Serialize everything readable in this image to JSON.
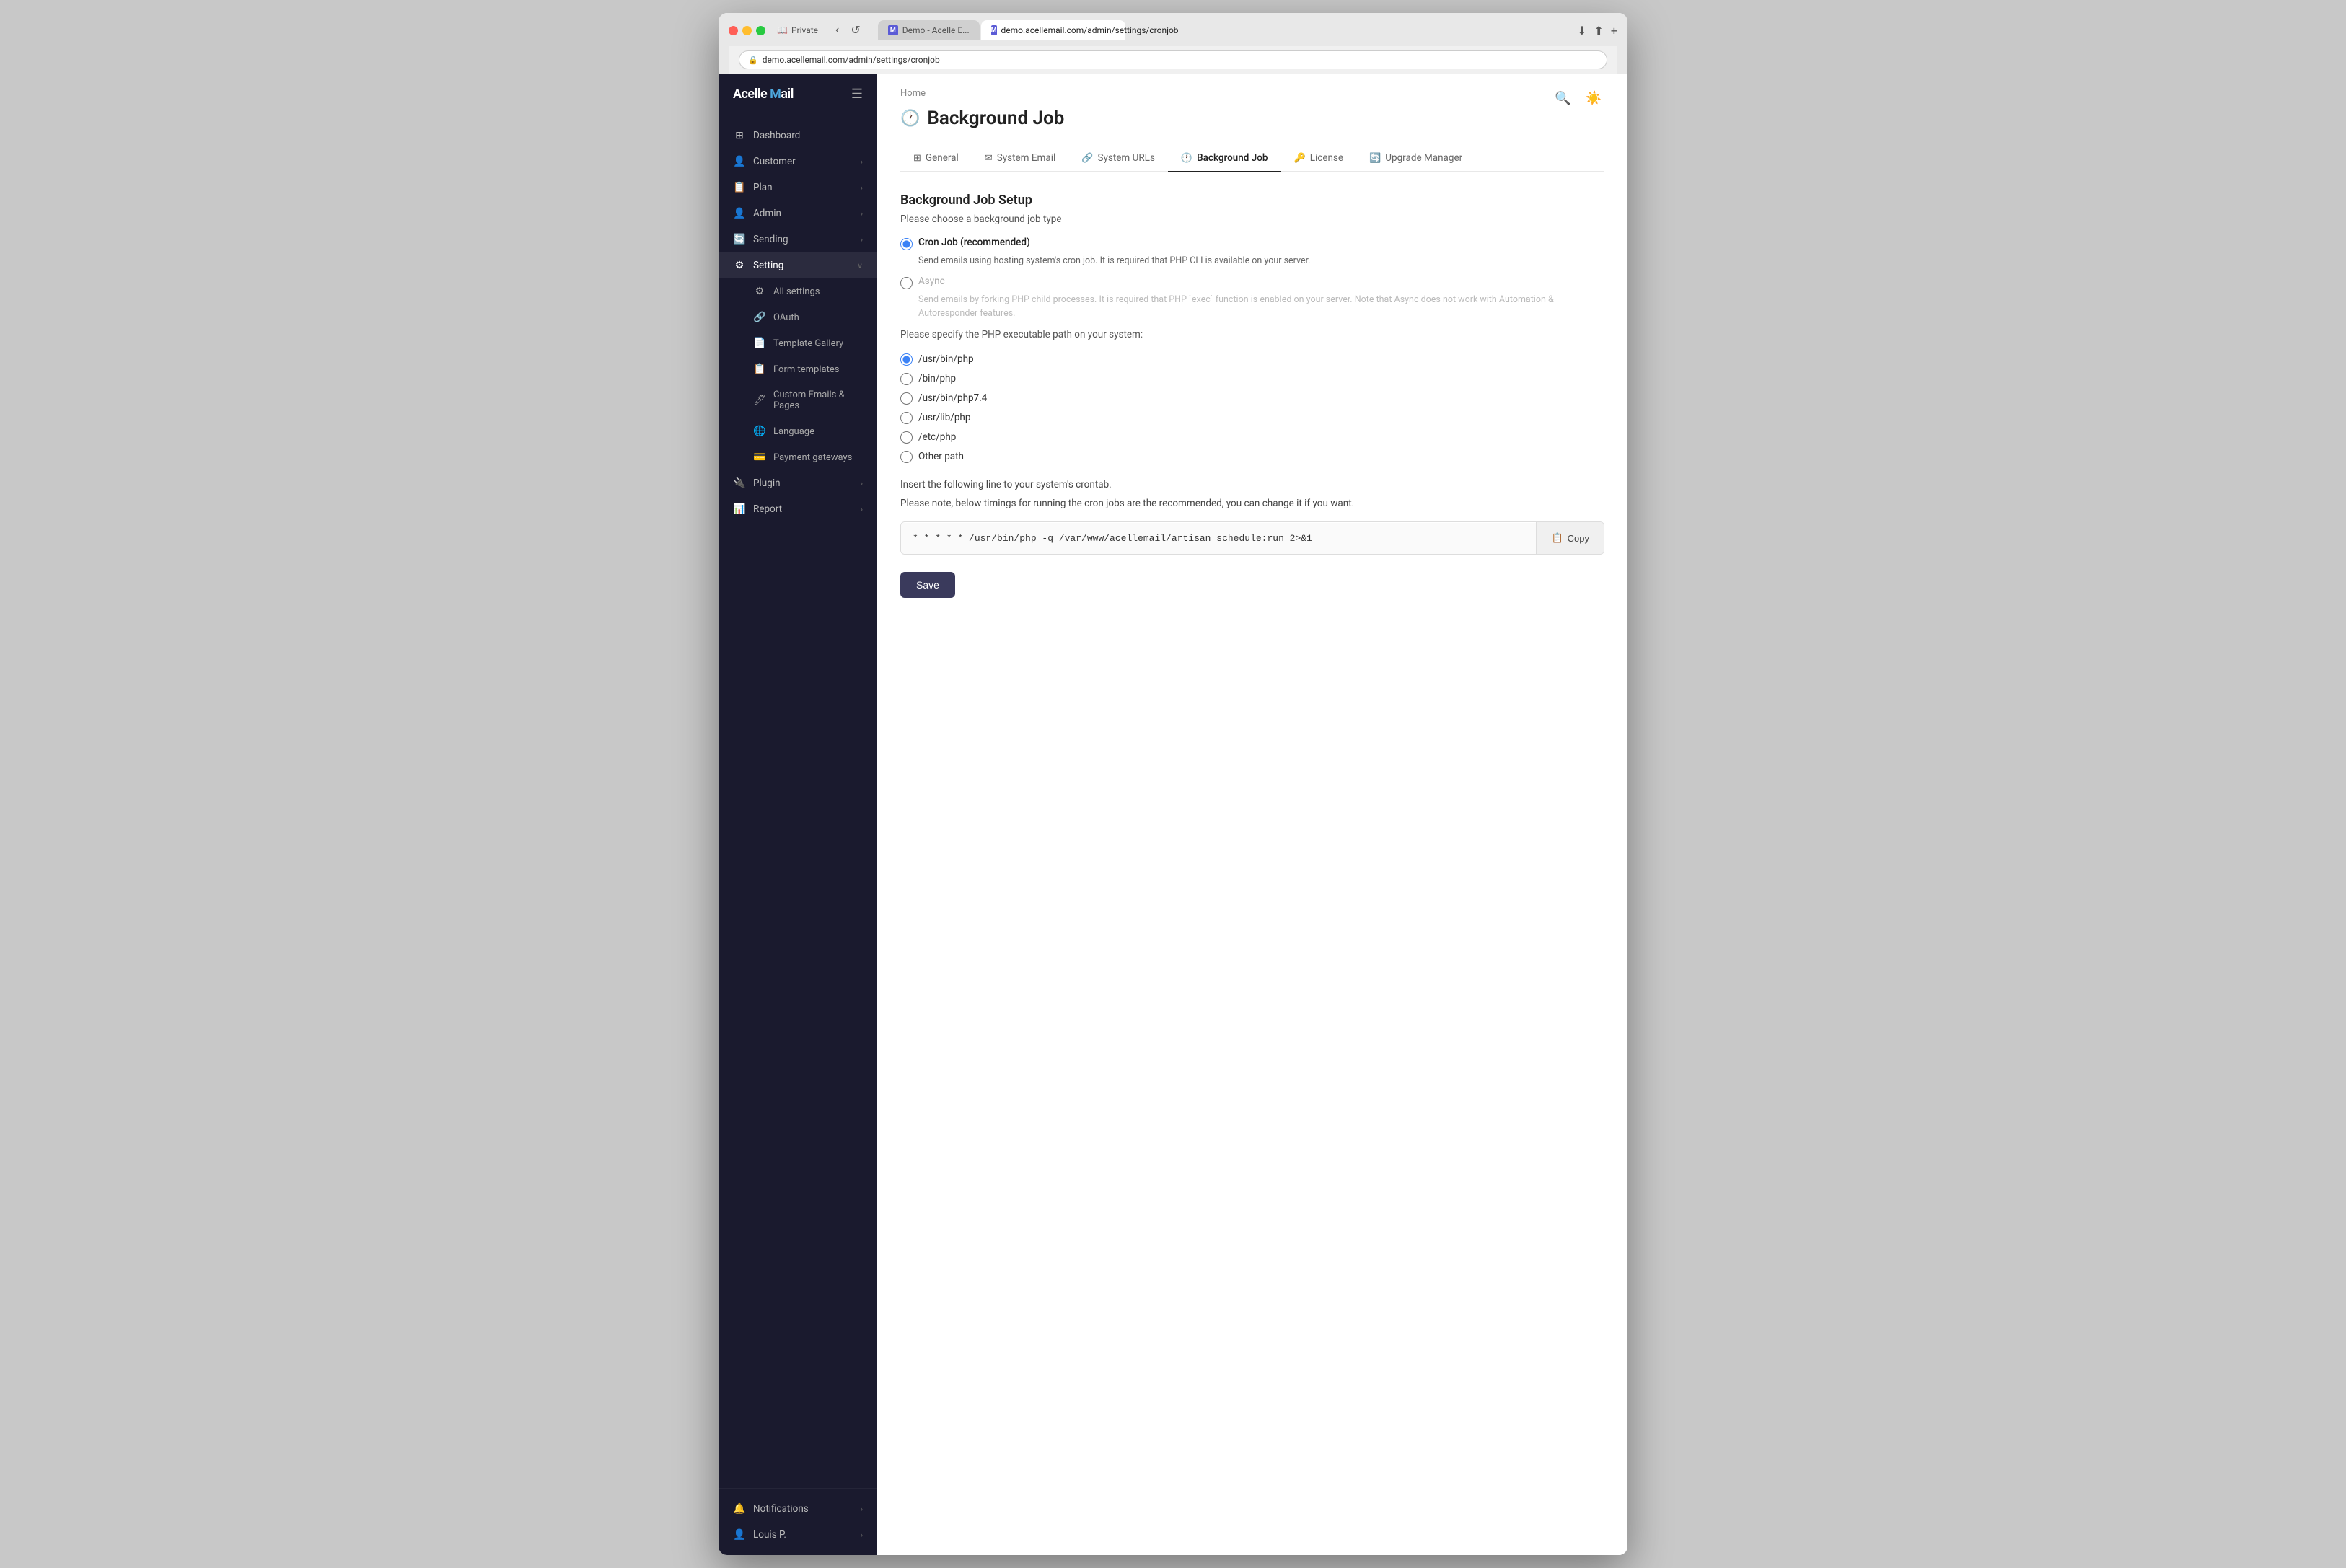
{
  "browser": {
    "tabs": [
      {
        "label": "Demo - Acelle E...",
        "active": false,
        "favicon": "M"
      },
      {
        "label": "demo.acellemail.com/admin/settings/cronjob",
        "active": true,
        "favicon": "M"
      }
    ],
    "address": "demo.acellemail.com/admin/settings/cronjob",
    "private_label": "Private"
  },
  "sidebar": {
    "logo": "Acelle Mail",
    "logo_accent": "M",
    "items": [
      {
        "id": "dashboard",
        "label": "Dashboard",
        "icon": "⊞",
        "has_arrow": false
      },
      {
        "id": "customer",
        "label": "Customer",
        "icon": "👤",
        "has_arrow": true
      },
      {
        "id": "plan",
        "label": "Plan",
        "icon": "📋",
        "has_arrow": true
      },
      {
        "id": "admin",
        "label": "Admin",
        "icon": "👤",
        "has_arrow": true
      },
      {
        "id": "sending",
        "label": "Sending",
        "icon": "🔄",
        "has_arrow": true
      },
      {
        "id": "setting",
        "label": "Setting",
        "icon": "⚙️",
        "has_arrow": true,
        "active": true
      },
      {
        "id": "all-settings",
        "label": "All settings",
        "icon": "⚙️",
        "sub": true
      },
      {
        "id": "oauth",
        "label": "OAuth",
        "icon": "🔗",
        "sub": true
      },
      {
        "id": "template-gallery",
        "label": "Template Gallery",
        "icon": "📄",
        "sub": true
      },
      {
        "id": "form-templates",
        "label": "Form templates",
        "icon": "📋",
        "sub": true
      },
      {
        "id": "custom-emails-pages",
        "label": "Custom Emails & Pages",
        "icon": "🖊️",
        "sub": true
      },
      {
        "id": "language",
        "label": "Language",
        "icon": "🌐",
        "sub": true
      },
      {
        "id": "payment-gateways",
        "label": "Payment gateways",
        "icon": "💳",
        "sub": true
      },
      {
        "id": "plugin",
        "label": "Plugin",
        "icon": "🔌",
        "has_arrow": true
      },
      {
        "id": "report",
        "label": "Report",
        "icon": "📊",
        "has_arrow": true
      }
    ],
    "bottom_items": [
      {
        "id": "notifications",
        "label": "Notifications",
        "icon": "🔔",
        "has_arrow": true
      },
      {
        "id": "louis",
        "label": "Louis P.",
        "icon": "👤",
        "has_arrow": true
      }
    ]
  },
  "main": {
    "breadcrumb": "Home",
    "page_title": "Background Job",
    "page_title_icon": "🕐",
    "header_actions": {
      "search_icon": "🔍",
      "theme_icon": "☀️"
    },
    "tabs": [
      {
        "id": "general",
        "label": "General",
        "icon": "⊞",
        "active": false
      },
      {
        "id": "system-email",
        "label": "System Email",
        "icon": "✉️",
        "active": false
      },
      {
        "id": "system-urls",
        "label": "System URLs",
        "icon": "🔗",
        "active": false
      },
      {
        "id": "background-job",
        "label": "Background Job",
        "icon": "🕐",
        "active": true
      },
      {
        "id": "license",
        "label": "License",
        "icon": "🔑",
        "active": false
      },
      {
        "id": "upgrade-manager",
        "label": "Upgrade Manager",
        "icon": "🔄",
        "active": false
      }
    ],
    "setup": {
      "title": "Background Job Setup",
      "choose_label": "Please choose a background job type",
      "job_types": [
        {
          "id": "cron",
          "label": "Cron Job (recommended)",
          "description": "Send emails using hosting system's cron job. It is required that PHP CLI is available on your server.",
          "selected": true,
          "disabled": false
        },
        {
          "id": "async",
          "label": "Async",
          "description": "Send emails by forking PHP child processes. It is required that PHP `exec` function is enabled on your server. Note that Async does not work with Automation & Autoresponder features.",
          "selected": false,
          "disabled": true
        }
      ],
      "php_path_label": "Please specify the PHP executable path on your system:",
      "php_paths": [
        {
          "id": "usr-bin-php",
          "value": "/usr/bin/php",
          "selected": true
        },
        {
          "id": "bin-php",
          "value": "/bin/php",
          "selected": false
        },
        {
          "id": "usr-bin-php7",
          "value": "/usr/bin/php7.4",
          "selected": false
        },
        {
          "id": "usr-lib-php",
          "value": "/usr/lib/php",
          "selected": false
        },
        {
          "id": "etc-php",
          "value": "/etc/php",
          "selected": false
        },
        {
          "id": "other",
          "value": "Other path",
          "selected": false
        }
      ],
      "crontab": {
        "line1": "Insert the following line to your system's crontab.",
        "line2": "Please note, below timings for running the cron jobs are the recommended, you can change it if you want.",
        "command": "* * * * * /usr/bin/php -q /var/www/acellemail/artisan schedule:run 2>&1",
        "copy_label": "Copy"
      },
      "save_label": "Save"
    }
  }
}
